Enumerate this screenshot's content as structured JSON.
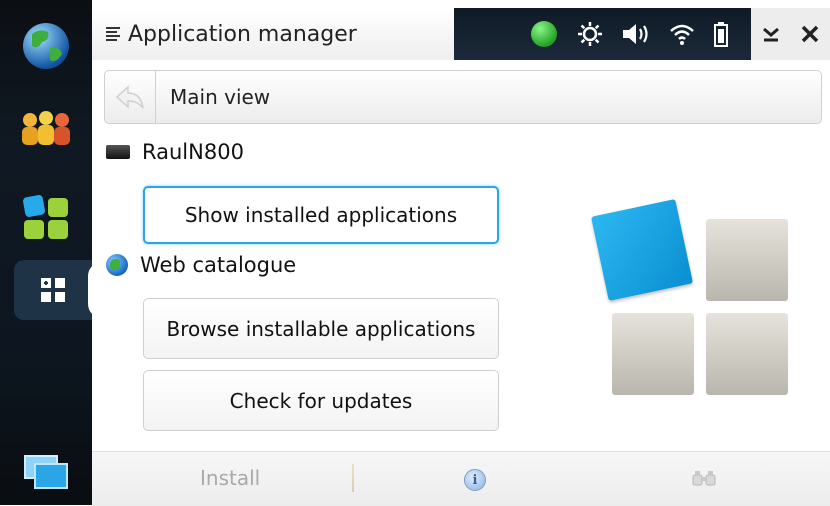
{
  "window": {
    "title": "Application manager"
  },
  "launcher": {
    "items": [
      {
        "name": "globe-icon"
      },
      {
        "name": "contacts-icon"
      },
      {
        "name": "apps-grid-icon"
      },
      {
        "name": "app-manager-icon"
      },
      {
        "name": "task-switcher-icon"
      }
    ]
  },
  "status": {
    "icons": [
      "presence-icon",
      "brightness-icon",
      "volume-icon",
      "wifi-icon",
      "battery-icon"
    ],
    "presence_color": "#2dbf2d"
  },
  "breadcrumb": {
    "label": "Main view"
  },
  "device_section": {
    "label": "RaulN800",
    "button": "Show installed applications"
  },
  "web_section": {
    "label": "Web catalogue",
    "buttons": [
      "Browse installable applications",
      "Check for updates"
    ]
  },
  "toolbar": {
    "install_label": "Install"
  },
  "colors": {
    "accent": "#2aa6e6",
    "logo_blue": "#1aa4e2"
  }
}
